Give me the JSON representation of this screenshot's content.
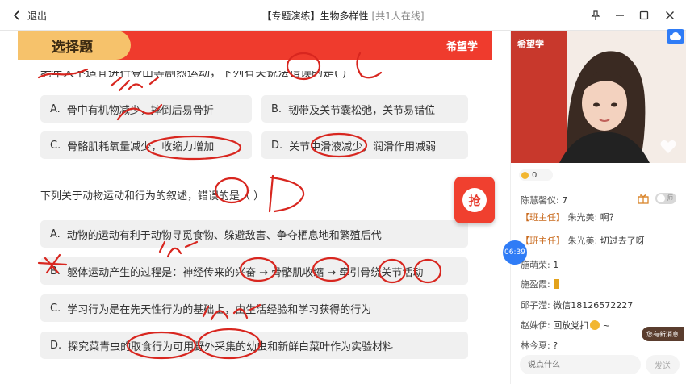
{
  "window": {
    "back_label": "退出",
    "title": "【专题演练】生物多样性",
    "online": "[共1人在线]"
  },
  "slide": {
    "tab_label": "选择题",
    "brand": "希望学",
    "cut_question": "老年人不适宜进行登山等剧烈运动，下列有关说法错误的是(      )",
    "q1_options": [
      {
        "letter": "A.",
        "text": "骨中有机物减少，摔倒后易骨折"
      },
      {
        "letter": "B.",
        "text": "韧带及关节囊松弛，关节易错位"
      },
      {
        "letter": "C.",
        "text": "骨骼肌耗氧量减少，收缩力增加"
      },
      {
        "letter": "D.",
        "text": "关节中滑液减少，润滑作用减弱"
      }
    ],
    "q2": "下列关于动物运动和行为的叙述，错误的是（   ）",
    "q2_options": [
      {
        "letter": "A.",
        "text": "动物的运动有利于动物寻觅食物、躲避敌害、争夺栖息地和繁殖后代"
      },
      {
        "letter": "B.",
        "text": "躯体运动产生的过程是：神经传来的兴奋 → 骨骼肌收缩 → 牵引骨绕关节活动"
      },
      {
        "letter": "C.",
        "text": "学习行为是在先天性行为的基础上，由生活经验和学习获得的行为"
      },
      {
        "letter": "D.",
        "text": "探究菜青虫的取食行为可用野外采集的幼虫和新鲜白菜叶作为实验材料"
      }
    ],
    "grab_label": "抢"
  },
  "panel": {
    "video_brand": "希望学",
    "likes": "0",
    "messages": [
      {
        "role": "",
        "name": "陈慧馨仪:",
        "text": "7"
      },
      {
        "role": "【班主任】",
        "name": "朱光美:",
        "text": "啊？"
      },
      {
        "role": "【班主任】",
        "name": "朱光美:",
        "text": "切过去了呀"
      },
      {
        "role": "",
        "name": "施萌荣:",
        "text": "1"
      },
      {
        "role": "",
        "name": "施盈霞:",
        "text": ""
      },
      {
        "role": "",
        "name": "邱子滢:",
        "text": "微信18126572227"
      },
      {
        "role": "",
        "name": "赵姝伊:",
        "text": "回放党扣"
      },
      {
        "role": "",
        "name": "林今夏:",
        "text": "?"
      }
    ],
    "trailing_tilde": "~",
    "toggle_label": "师",
    "timer": "06:39",
    "new_message": "您有新消息",
    "input_placeholder": "说点什么",
    "send_label": "发送"
  },
  "colors": {
    "accent_red": "#ef3b2d",
    "tab_gold": "#f6c26b",
    "teacher_orange": "#c96a1d",
    "blue": "#2f7cf6"
  }
}
